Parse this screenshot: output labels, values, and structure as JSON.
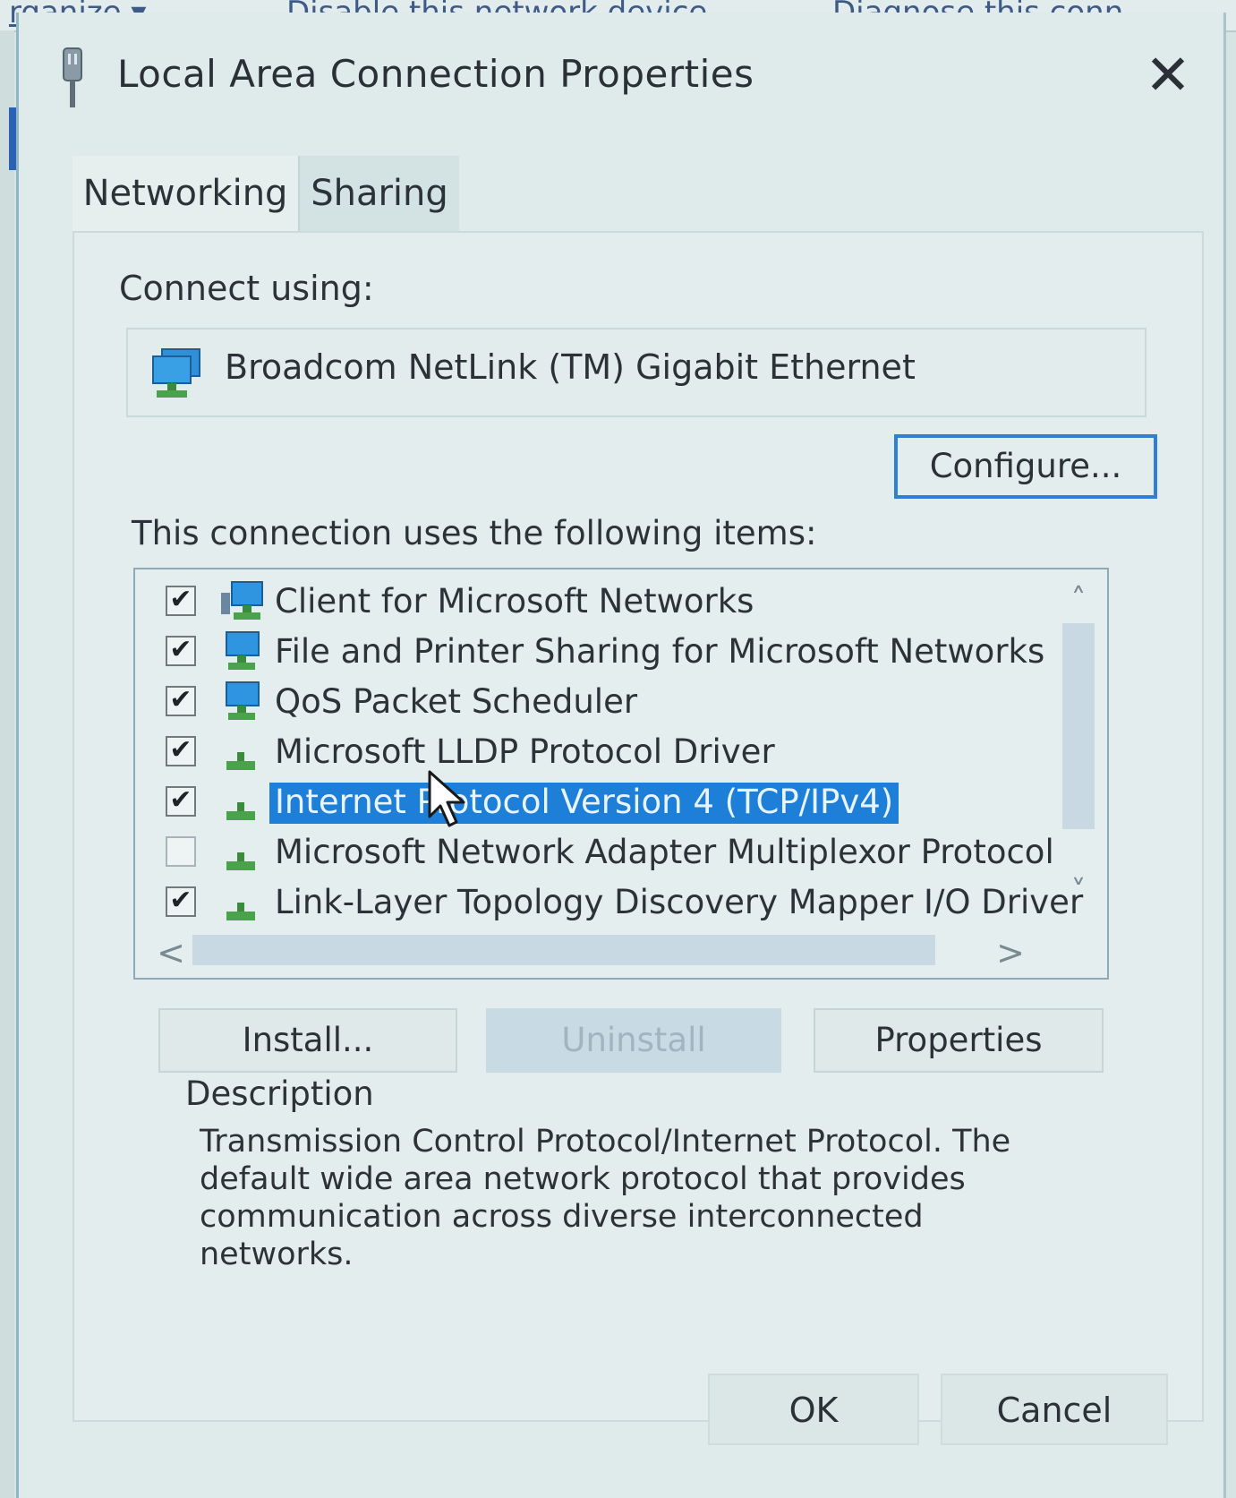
{
  "background_window": {
    "toolbar_items": [
      "rganize ▾",
      "Disable this network device",
      "Diagnose this conn"
    ]
  },
  "dialog": {
    "title": "Local Area Connection Properties",
    "close_label": "✕",
    "tabs": [
      {
        "label": "Networking",
        "active": true
      },
      {
        "label": "Sharing",
        "active": false
      }
    ],
    "connect_using_label": "Connect using:",
    "adapter_name": "Broadcom NetLink (TM) Gigabit Ethernet",
    "configure_label": "Configure...",
    "items_label": "This connection uses the following items:",
    "items": [
      {
        "label": "Client for Microsoft Networks",
        "checked": true,
        "icon": "network-client-icon",
        "selected": false
      },
      {
        "label": "File and Printer Sharing for Microsoft Networks",
        "checked": true,
        "icon": "network-service-icon",
        "selected": false
      },
      {
        "label": "QoS Packet Scheduler",
        "checked": true,
        "icon": "network-service-icon",
        "selected": false
      },
      {
        "label": "Microsoft LLDP Protocol Driver",
        "checked": true,
        "icon": "protocol-icon",
        "selected": false
      },
      {
        "label": "Internet Protocol Version 4 (TCP/IPv4)",
        "checked": true,
        "icon": "protocol-icon",
        "selected": true
      },
      {
        "label": "Microsoft Network Adapter Multiplexor Protocol",
        "checked": false,
        "icon": "protocol-icon",
        "selected": false
      },
      {
        "label": "Link-Layer Topology Discovery Mapper I/O Driver",
        "checked": true,
        "icon": "protocol-icon",
        "selected": false
      }
    ],
    "check_mark": "✔",
    "scroll": {
      "up": "˄",
      "down": "˅",
      "left": "<",
      "right": ">"
    },
    "install_label": "Install...",
    "uninstall_label": "Uninstall",
    "properties_label": "Properties",
    "description_label": "Description",
    "description_text": "Transmission Control Protocol/Internet Protocol. The default wide area network protocol that provides communication across diverse interconnected networks.",
    "ok_label": "OK",
    "cancel_label": "Cancel"
  },
  "colors": {
    "selection": "#1e7fd8",
    "focus_border": "#2f7fd6",
    "background": "#dfeaea"
  }
}
